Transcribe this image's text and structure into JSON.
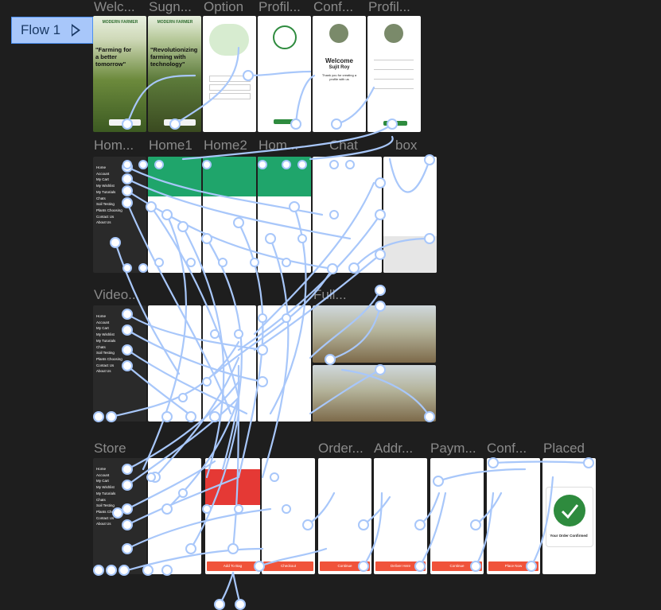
{
  "flow": {
    "label": "Flow 1"
  },
  "colors": {
    "canvas": "#1e1e1e",
    "connector": "#a8c7fa",
    "accent_green": "#2e8b3e",
    "accent_red": "#f0533a"
  },
  "frames": [
    {
      "id": "f1",
      "label": "Welc..."
    },
    {
      "id": "f2",
      "label": "Sugn..."
    },
    {
      "id": "f3",
      "label": "Option"
    },
    {
      "id": "f4",
      "label": "Profil..."
    },
    {
      "id": "f5",
      "label": "Conf..."
    },
    {
      "id": "f6",
      "label": "Profil..."
    },
    {
      "id": "f7",
      "label": "Hom..."
    },
    {
      "id": "f8",
      "label": "Home1"
    },
    {
      "id": "f9",
      "label": "Home2"
    },
    {
      "id": "f10",
      "label": "Hom..."
    },
    {
      "id": "f11",
      "label": "Chat"
    },
    {
      "id": "f12",
      "label": "box"
    },
    {
      "id": "f13",
      "label": "Video..."
    },
    {
      "id": "f14",
      "label": "Full..."
    },
    {
      "id": "f15",
      "label": "Store"
    },
    {
      "id": "f16",
      "label": "Order..."
    },
    {
      "id": "f17",
      "label": "Addr..."
    },
    {
      "id": "f18",
      "label": "Paym..."
    },
    {
      "id": "f19",
      "label": "Conf..."
    },
    {
      "id": "f20",
      "label": "Placed"
    }
  ],
  "welcome": {
    "brand": "MODERN FARMER",
    "quote": "\"Farming for a better tomorrow\""
  },
  "signup": {
    "quote": "\"Revolutionizing farming with technology\""
  },
  "confirm": {
    "title": "Welcome",
    "name": "Sujit Roy",
    "subtitle": "Thank you for creating a profile with us"
  },
  "menu": {
    "items": [
      "Home",
      "Account",
      "My Cart",
      "My Wishlist",
      "My Tutorials",
      "Chats",
      "Soil Testing",
      "Plants Choosing",
      "Contact Us",
      "About Us"
    ]
  },
  "placed": {
    "message": "Your Order Confirmed"
  },
  "store_buttons": {
    "add_to_bag": "Add To Bag",
    "checkout": "Checkout",
    "continue": "Continue",
    "deliver_here": "Deliver Here",
    "place_now": "Place Now"
  }
}
